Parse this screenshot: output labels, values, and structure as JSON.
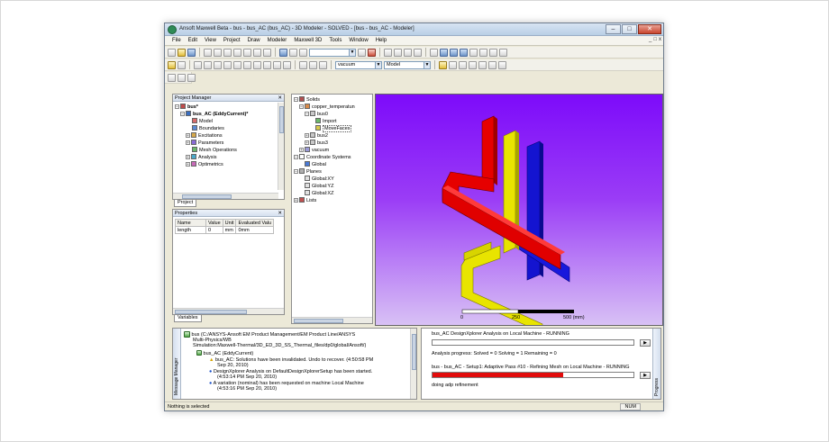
{
  "window": {
    "title": "Ansoft Maxwell Beta - bus - bus_AC (bus_AC) - 3D Modeler - SOLVED - [bus - bus_AC - Modeler]",
    "buttons": [
      "–",
      "□",
      "✕"
    ]
  },
  "menu": [
    "File",
    "Edit",
    "View",
    "Project",
    "Draw",
    "Modeler",
    "Maxwell 3D",
    "Tools",
    "Window",
    "Help"
  ],
  "mdi_buttons": [
    "_",
    "□",
    "x"
  ],
  "toolbar": {
    "material_select": "vacuum",
    "model_select": "Model"
  },
  "project_manager": {
    "title": "Project Manager",
    "tree": [
      {
        "label": "bus*",
        "level": 0,
        "bold": true
      },
      {
        "label": "bus_AC (EddyCurrent)*",
        "level": 1,
        "bold": true
      },
      {
        "label": "Model",
        "level": 2
      },
      {
        "label": "Boundaries",
        "level": 2
      },
      {
        "label": "Excitations",
        "level": 2
      },
      {
        "label": "Parameters",
        "level": 2
      },
      {
        "label": "Mesh Operations",
        "level": 2
      },
      {
        "label": "Analysis",
        "level": 2
      },
      {
        "label": "Optimetrics",
        "level": 2
      }
    ],
    "tab": "Project"
  },
  "properties": {
    "title": "Properties",
    "headers": [
      "Name",
      "Value",
      "Unit",
      "Evaluated Valu"
    ],
    "rows": [
      [
        "length",
        "0",
        "mm",
        "0mm"
      ]
    ],
    "tab": "Variables"
  },
  "model_tree": [
    {
      "label": "Solids",
      "level": 0
    },
    {
      "label": "copper_temperatun",
      "level": 1
    },
    {
      "label": "bus0",
      "level": 2
    },
    {
      "label": "Import",
      "level": 3
    },
    {
      "label": "MoveFaces",
      "level": 3
    },
    {
      "label": "bus2",
      "level": 2
    },
    {
      "label": "bus3",
      "level": 2
    },
    {
      "label": "vacuum",
      "level": 1
    },
    {
      "label": "Coordinate Systems",
      "level": 0
    },
    {
      "label": "Global",
      "level": 1
    },
    {
      "label": "Planes",
      "level": 0
    },
    {
      "label": "Global:XY",
      "level": 1
    },
    {
      "label": "Global:YZ",
      "level": 1
    },
    {
      "label": "Global:XZ",
      "level": 1
    },
    {
      "label": "Lists",
      "level": 0
    }
  ],
  "scale_bar": {
    "labels": [
      "0",
      "250",
      "500 (mm)"
    ]
  },
  "message_manager": {
    "side_label": "Message Manager",
    "lines": [
      "bus (C:/ANSYS-Ansoft EM Product Management/EM Product Line/ANSYS",
      "Multi-Physics/WB",
      "Simulation:Maxwell-Thermal/3D_ED_3D_SS_Thermal_files/dp0/global/Ansoft/)",
      "bus_AC (EddyCurrent)",
      "bus_AC: Solutions have been invalidated. Undo to recover. (4:50:58 PM",
      "Sep 20, 2010)",
      "DesignXplorer Analysis on DefaultDesignXplorerSetup has been started.",
      "(4:53:14 PM  Sep 20, 2010)",
      "A variation (nominal) has been requested on machine Local Machine",
      "(4:53:16 PM  Sep 20, 2010)"
    ]
  },
  "progress": {
    "side_label": "Progress",
    "job1": "bus_AC DesignXplorer Analysis on Local Machine - RUNNING",
    "job1_status": "Analysis progress:   Solved = 0   Solving = 1   Remaining = 0",
    "job2": "bus - bus_AC - Setup1: Adaptive Pass #10 - Refining Mesh on Local Machine - RUNNING",
    "job2_fraction": 0.65,
    "job2_status": "doing adp refinement",
    "play_glyph": "▶"
  },
  "status_bar": {
    "text": "Nothing is selected",
    "num": "NUM"
  },
  "colors": {
    "bus_red": "#e60000",
    "bus_yellow": "#e8e800",
    "bus_blue": "#1010d8",
    "viewport_top": "#7d0bfa",
    "viewport_bottom": "#d8c1f5"
  }
}
